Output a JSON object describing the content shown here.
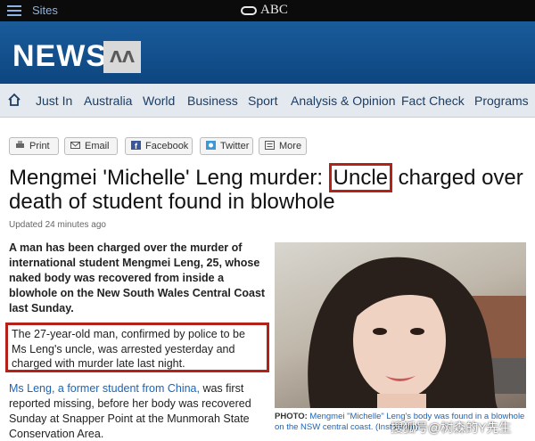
{
  "topbar": {
    "sites": "Sites",
    "abc": "ABC"
  },
  "header": {
    "logo": "NEWS",
    "badge": "ᐱᐱ"
  },
  "nav": {
    "items": [
      "Just In",
      "Australia",
      "World",
      "Business",
      "Sport",
      "Analysis & Opinion",
      "Fact Check",
      "Programs"
    ]
  },
  "share": {
    "print": "Print",
    "email": "Email",
    "facebook": "Facebook",
    "twitter": "Twitter",
    "more": "More"
  },
  "article": {
    "headline_before": "Mengmei 'Michelle' Leng murder: ",
    "headline_boxed": "Uncle",
    "headline_after": " charged over death of student found in blowhole",
    "updated": "Updated 24 minutes ago",
    "lede": "A man has been charged over the murder of international student Mengmei Leng, 25, whose naked body was recovered from inside a blowhole on the New South Wales Central Coast last Sunday.",
    "quote": "The 27-year-old man, confirmed by police to be Ms Leng's uncle, was arrested yesterday and charged with murder late last night.",
    "para_link": "Ms Leng, a former student from China,",
    "para_rest": " was first reported missing, before her body was recovered Sunday at Snapper Point at the Munmorah State Conservation Area.",
    "caption_label": "PHOTO:",
    "caption_text": " Mengmei \"Michelle\" Leng's body was found in a blowhole on the NSW central coast. (Instagram)"
  },
  "watermark": "搜狐号@树森的Y先生",
  "colors": {
    "highlight_border": "#b32218",
    "news_blue": "#0f4d8a",
    "link": "#1c64b4"
  }
}
